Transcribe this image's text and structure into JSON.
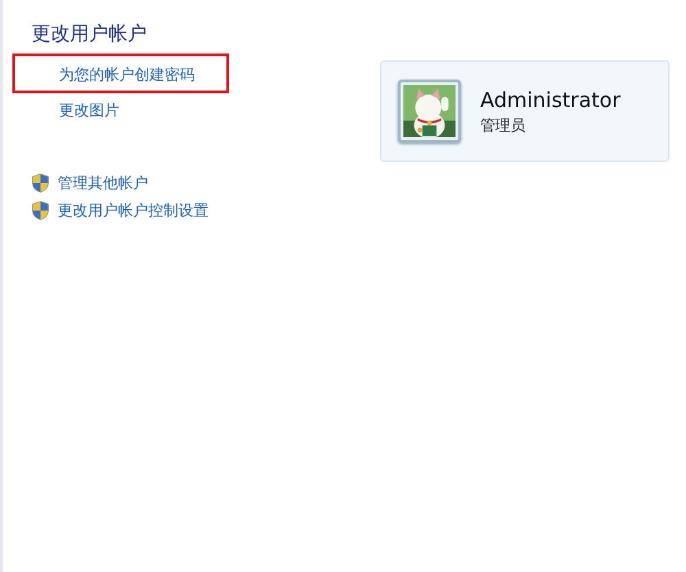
{
  "heading": "更改用户帐户",
  "links": [
    {
      "label": "为您的帐户创建密码",
      "highlighted": true
    },
    {
      "label": "更改图片",
      "highlighted": false
    }
  ],
  "admin_links": [
    {
      "label": "管理其他帐户",
      "kind": "shield"
    },
    {
      "label": "更改用户帐户控制设置",
      "kind": "shield"
    }
  ],
  "account": {
    "name": "Administrator",
    "role": "管理员"
  }
}
